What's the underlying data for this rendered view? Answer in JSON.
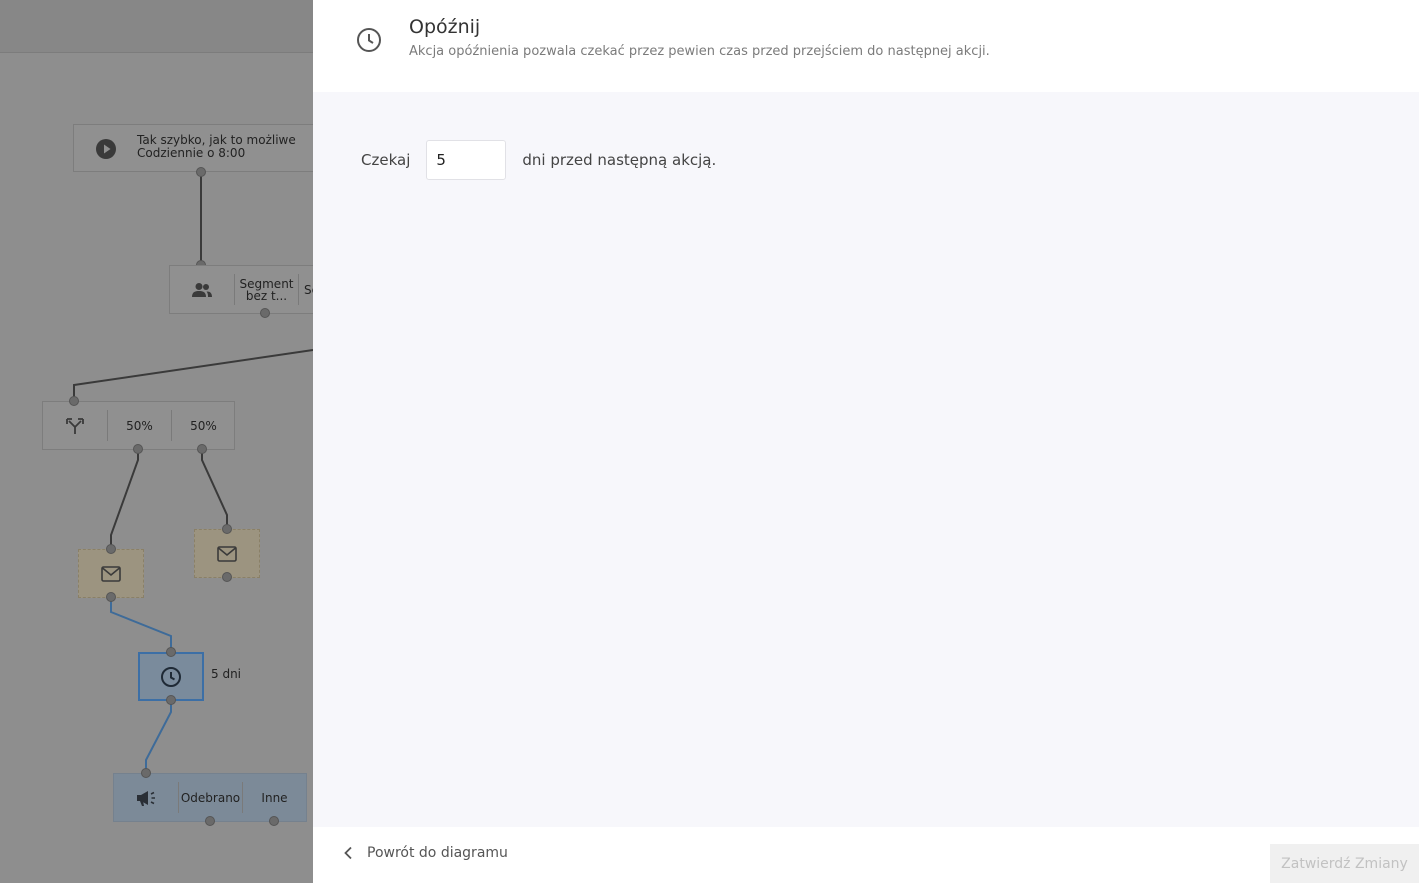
{
  "diagram": {
    "trigger": {
      "line1": "Tak szybko, jak to możliwe",
      "line2": "Codziennie o 8:00"
    },
    "segment": {
      "label1": "Segment bez t...",
      "label2": "Se..."
    },
    "split": {
      "branch_a": "50%",
      "branch_b": "50%"
    },
    "delay": {
      "label": "5 dni"
    },
    "campaign": {
      "received": "Odebrano",
      "other": "Inne"
    }
  },
  "panel": {
    "title": "Opóźnij",
    "description": "Akcja opóźnienia pozwala czekać przez pewien czas przed przejściem do następnej akcji.",
    "wait_prefix": "Czekaj",
    "wait_value": "5",
    "wait_suffix": "dni przed następną akcją.",
    "back_label": "Powrót do diagramu",
    "confirm_label": "Zatwierdź Zmiany"
  },
  "colors": {
    "overlay": "#8e8e8e",
    "panel_bg": "#f7f7fb",
    "delay_accent": "#3c6fa6",
    "confirm_disabled_text": "#c2c2c2"
  }
}
